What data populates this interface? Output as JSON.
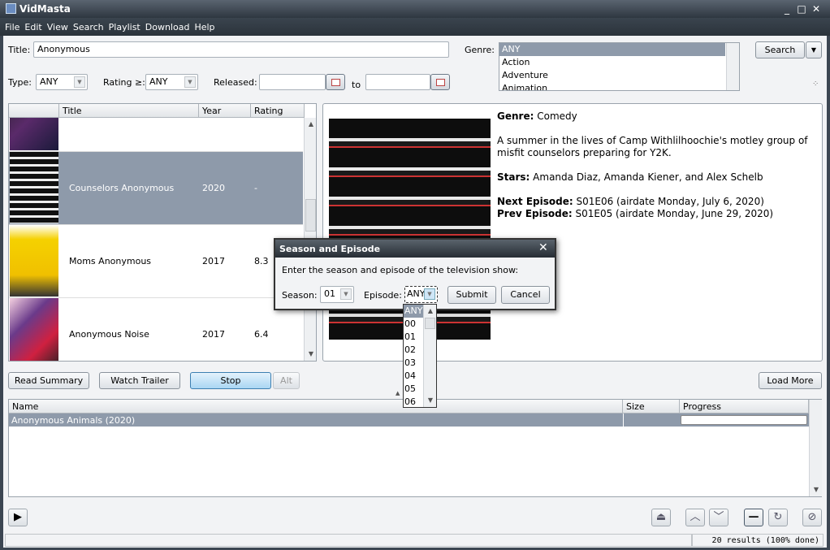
{
  "window": {
    "title": "VidMasta"
  },
  "menu": [
    "File",
    "Edit",
    "View",
    "Search",
    "Playlist",
    "Download",
    "Help"
  ],
  "search": {
    "title_label": "Title:",
    "title_value": "Anonymous",
    "genre_label": "Genre:",
    "genres": [
      "ANY",
      "Action",
      "Adventure",
      "Animation"
    ],
    "search_button": "Search",
    "type_label": "Type:",
    "type_value": "ANY",
    "rating_label": "Rating ≥:",
    "rating_value": "ANY",
    "released_label": "Released:",
    "to_label": "to",
    "released_from": "",
    "released_to": ""
  },
  "results": {
    "columns": [
      "",
      "Title",
      "Year",
      "Rating"
    ],
    "rows": [
      {
        "title": "",
        "year": "",
        "rating": ""
      },
      {
        "title": "Counselors Anonymous",
        "year": "2020",
        "rating": "-",
        "selected": true
      },
      {
        "title": "Moms Anonymous",
        "year": "2017",
        "rating": "8.3"
      },
      {
        "title": "Anonymous Noise",
        "year": "2017",
        "rating": "6.4"
      }
    ]
  },
  "details": {
    "genre_label": "Genre:",
    "genre": "Comedy",
    "summary": "A summer in the lives of Camp Withlilhoochie's motley group of misfit counselors preparing for Y2K.",
    "stars_label": "Stars:",
    "stars": "Amanda Diaz, Amanda Kiener, and Alex Schelb",
    "next_label": "Next Episode:",
    "next": "S01E06 (airdate Monday, July 6, 2020)",
    "prev_label": "Prev Episode:",
    "prev": "S01E05 (airdate Monday, June 29, 2020)"
  },
  "buttons": {
    "read_summary": "Read Summary",
    "watch_trailer": "Watch Trailer",
    "stop": "Stop",
    "alt": "Alt",
    "load_more": "Load More"
  },
  "downloads": {
    "columns": [
      "Name",
      "Size",
      "Progress"
    ],
    "rows": [
      {
        "name": "Anonymous Animals (2020)",
        "size": "",
        "progress": 0
      }
    ]
  },
  "status": {
    "text": "20 results (100% done)"
  },
  "dialog": {
    "title": "Season and Episode",
    "prompt": "Enter the season and episode of the television show:",
    "season_label": "Season:",
    "season_value": "01",
    "episode_label": "Episode:",
    "episode_value": "ANY",
    "submit": "Submit",
    "cancel": "Cancel",
    "episode_options": [
      "ANY",
      "00",
      "01",
      "02",
      "03",
      "04",
      "05",
      "06"
    ]
  }
}
